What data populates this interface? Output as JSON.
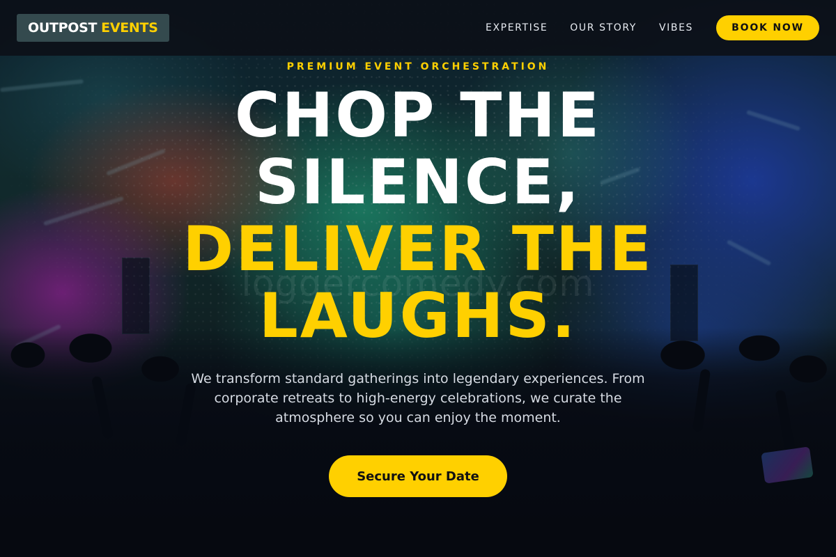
{
  "brand": {
    "name_part1": "OUTPOST",
    "name_part2": "EVENTS"
  },
  "nav": {
    "links": [
      {
        "label": "EXPERTISE"
      },
      {
        "label": "OUR STORY"
      },
      {
        "label": "VIBES"
      }
    ],
    "cta_label": "BOOK NOW"
  },
  "hero": {
    "eyebrow": "PREMIUM EVENT ORCHESTRATION",
    "headline_lines": [
      "CHOP THE",
      "SILENCE,",
      "DELIVER THE",
      "LAUGHS."
    ],
    "subtext": "We transform standard gatherings into legendary experiences. From corporate retreats to high-energy celebrations, we curate the atmosphere so you can enjoy the moment.",
    "cta_label": "Secure Your Date"
  },
  "watermark": "loggercomedy.com",
  "colors": {
    "accent": "#ffd000",
    "navbar_bg": "#0c1018",
    "logo_bg": "#344a4e",
    "headline_primary": "#ffffff"
  }
}
